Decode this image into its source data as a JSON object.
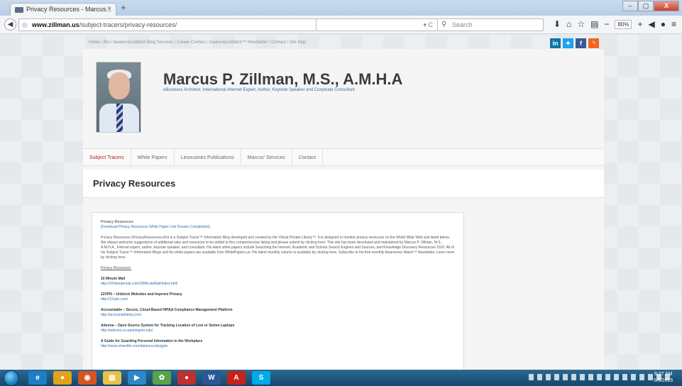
{
  "browser": {
    "tab_title": "Privacy Resources - Marcus...",
    "tab_close": "×",
    "new_tab": "+",
    "url_domain": "www.zillman.us",
    "url_path": "/subject-tracers/privacy-resources/",
    "reload": "▾ C",
    "search_placeholder": "Search",
    "zoom": "80%",
    "window_buttons": [
      "–",
      "▢",
      "X"
    ]
  },
  "page": {
    "breadcrumb": "Home  /  Bio  /  AwarenessWatch Blog   Services  /  Career Centers  /  AwarenessWatch™ Newsletter  /  Contact  /  Site Map",
    "social": [
      "in",
      "t",
      "f",
      "rss"
    ],
    "author_name": "Marcus P. Zillman, M.S., A.M.H.A",
    "tagline": "eBusiness Architect, International Internet Expert, Author, Keynote Speaker and Corporate Consultant",
    "menu": [
      "Subject Tracers",
      "White Papers",
      "Limousines Publications",
      "Marcus' Services",
      "Contact"
    ],
    "title": "Privacy Resources",
    "article": {
      "heading": "Privacy Resources",
      "download_link": "[Download Privacy Resources White Paper Link Dossier Compilation]",
      "intro": "Privacy Resources (PrivacyResources.info) is a Subject Tracer™ Information Blog developed and created by the Virtual Private Library™. It is designed to monitor privacy resources on the World Wide Web and listed below. We always welcome suggestions of additional sites and resources to be added to this comprehensive listing and please submit by clicking here. This site has been developed and maintained by Marcus P. Zillman, M.S., A.M.H.A., Internet expert, author, keynote speaker, and consultant. His latest white papers include Searching the Internet, Academic and Scholar Search Engines and Sources, and Knowledge Discovery Resources 2015. All of his Subject Tracer™ Information Blogs and his white papers are available from WhitePapers.us. His latest monthly column is available by clicking here. Subscribe to his free monthly Awareness Watch™ Newsletter. Learn more by clicking here.",
      "section_heading": "Privacy Resources:",
      "resources": [
        {
          "name": "10 Minute Mail",
          "url": "http://10minutemail.com/10MinuteMail/index.html"
        },
        {
          "name": "12VPN – Unblock Websites and Improve Privacy",
          "url": "http://12vpn.com/"
        },
        {
          "name": "Accountable – Secure, Cloud-Based HIPAA Compliance Management Platform",
          "url": "http://accountablehq.com/"
        },
        {
          "name": "Adeona – Open Source System for Tracking Location of Lost or Stolen Laptops",
          "url": "http://adeona.cs.washington.edu/"
        },
        {
          "name": "A Guide for Guarding Personal Information in the Workplace",
          "url": "http://www.sharefile.com/datasecurity/gpiw"
        }
      ]
    }
  },
  "taskbar": {
    "apps": [
      "e",
      "●",
      "◉",
      "▤",
      "▶",
      "✿",
      "●",
      "W",
      "A",
      "S"
    ],
    "clock_time": "9:27 AM",
    "clock_date": "5/5/2015"
  }
}
